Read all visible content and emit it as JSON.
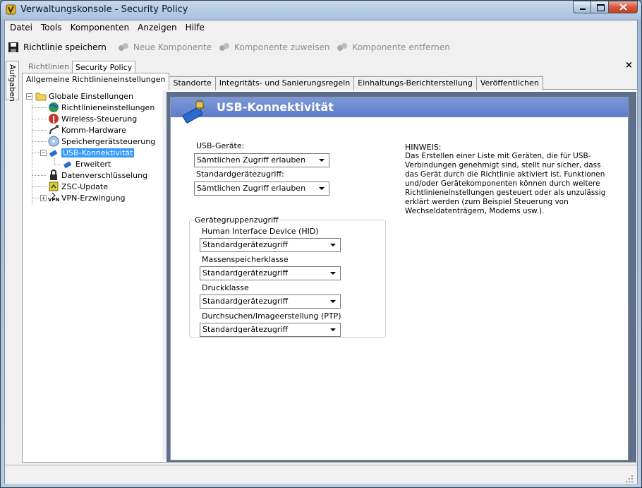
{
  "window": {
    "title": "Verwaltungskonsole - Security Policy"
  },
  "menu": [
    "Datei",
    "Tools",
    "Komponenten",
    "Anzeigen",
    "Hilfe"
  ],
  "toolbar": {
    "save": "Richtlinie speichern",
    "new_component": "Neue Komponente",
    "assign_component": "Komponente zuweisen",
    "remove_component": "Komponente entfernen"
  },
  "side_tab": "Aufgaben",
  "doc_tabs": [
    "Richtlinien",
    "Security Policy"
  ],
  "doc_close": "×",
  "main_tabs": [
    "Allgemeine Richtlinieneinstellungen",
    "Standorte",
    "Integritäts- und Sanierungsregeln",
    "Einhaltungs-Berichterstellung",
    "Veröffentlichen"
  ],
  "tree": {
    "root": "Globale Einstellungen",
    "items": [
      "Richtlinieneinstellungen",
      "Wireless-Steuerung",
      "Komm-Hardware",
      "Speichergerätsteuerung",
      "USB-Konnektivität",
      "Erweitert",
      "Datenverschlüsselung",
      "ZSC-Update",
      "VPN-Erzwingung"
    ]
  },
  "panel": {
    "title": "USB-Konnektivität",
    "usb_devices_label": "USB-Geräte:",
    "usb_devices_value": "Sämtlichen Zugriff erlauben",
    "default_access_label": "Standardgerätezugriff:",
    "default_access_value": "Sämtlichen Zugriff erlauben",
    "group": {
      "legend": "Gerätegruppenzugriff",
      "rows": [
        {
          "label": "Human Interface Device (HID)",
          "value": "Standardgerätezugriff"
        },
        {
          "label": "Massenspeicherklasse",
          "value": "Standardgerätezugriff"
        },
        {
          "label": "Druckklasse",
          "value": "Standardgerätezugriff"
        },
        {
          "label": "Durchsuchen/Imageerstellung (PTP)",
          "value": "Standardgerätezugriff"
        }
      ]
    },
    "note_title": "HINWEIS:",
    "note_text": "Das Erstellen einer Liste mit Geräten, die für USB-Verbindungen genehmigt sind, stellt nur sicher, dass das Gerät durch die Richtlinie aktiviert ist. Funktionen und/oder Gerätekomponenten können durch weitere Richtlinieneinstellungen gesteuert oder als unzulässig erklärt werden (zum Beispiel Steuerung von Wechseldatenträgern, Modems usw.)."
  },
  "colors": {
    "selection": "#3399ff",
    "header": "#6b88d0"
  }
}
